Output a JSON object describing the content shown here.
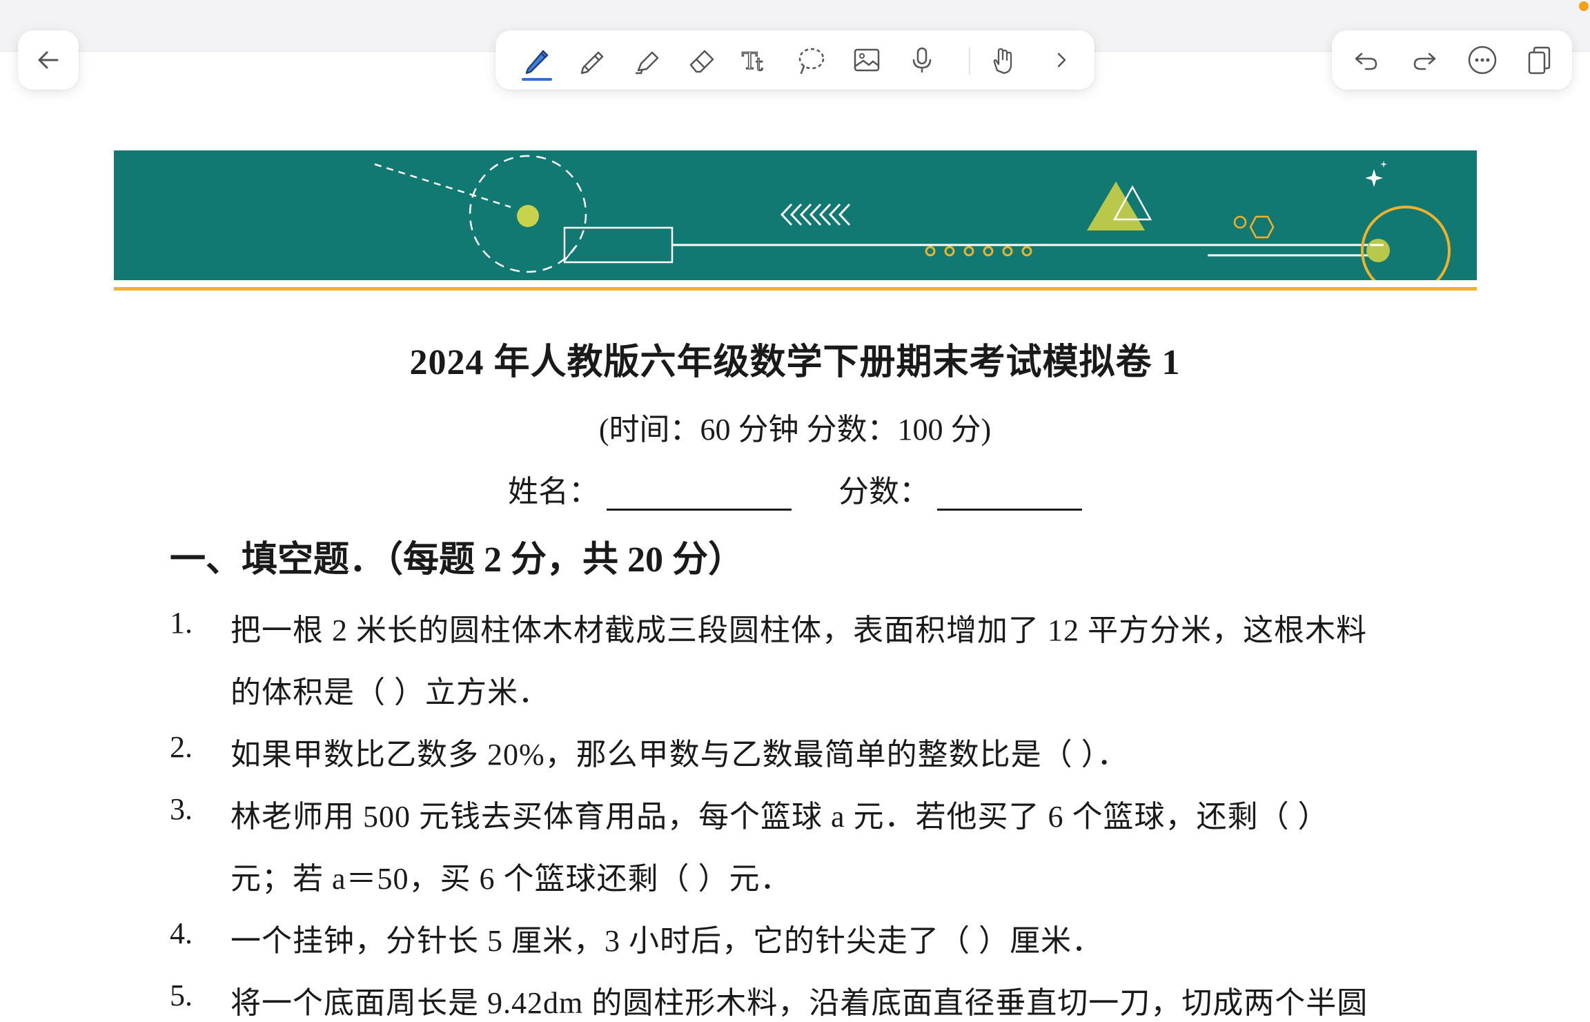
{
  "toolbar": {
    "back": "back-arrow-icon",
    "tools": [
      "pen-icon",
      "pencil-icon",
      "highlighter-icon",
      "eraser-icon",
      "text-tool-icon",
      "lasso-icon",
      "image-icon",
      "microphone-icon",
      "hand-touch-icon",
      "chevron-right-icon"
    ],
    "actions": [
      "undo-icon",
      "redo-icon",
      "more-icon",
      "pages-icon"
    ],
    "accent_color": "#2f6fd6",
    "notification_color": "#f2a21a"
  },
  "document": {
    "banner_color": "#127872",
    "banner_accent": "#f0b22a",
    "title": "2024 年人教版六年级数学下册期末考试模拟卷 1",
    "subtitle": "(时间：60 分钟    分数：100 分)",
    "name_label": "姓名：",
    "score_label": "分数：",
    "section_1": "一、填空题．（每题 2 分，共 20 分）",
    "questions": [
      {
        "num": "1.",
        "lines": [
          "把一根 2 米长的圆柱体木材截成三段圆柱体，表面积增加了 12 平方分米，这根木料",
          "的体积是（        ）立方米．"
        ]
      },
      {
        "num": "2.",
        "lines": [
          "如果甲数比乙数多 20%，那么甲数与乙数最简单的整数比是（        ）．"
        ]
      },
      {
        "num": "3.",
        "lines": [
          "林老师用 500 元钱去买体育用品，每个篮球 a 元．若他买了 6 个篮球，还剩（        ）",
          "元；若 a＝50，买 6 个篮球还剩（        ）元．"
        ]
      },
      {
        "num": "4.",
        "lines": [
          "一个挂钟，分针长 5 厘米，3 小时后，它的针尖走了（        ）厘米．"
        ]
      },
      {
        "num": "5.",
        "lines": [
          "将一个底面周长是 9.42dm 的圆柱形木料，沿着底面直径垂直切一刀，切成两个半圆"
        ]
      }
    ]
  }
}
